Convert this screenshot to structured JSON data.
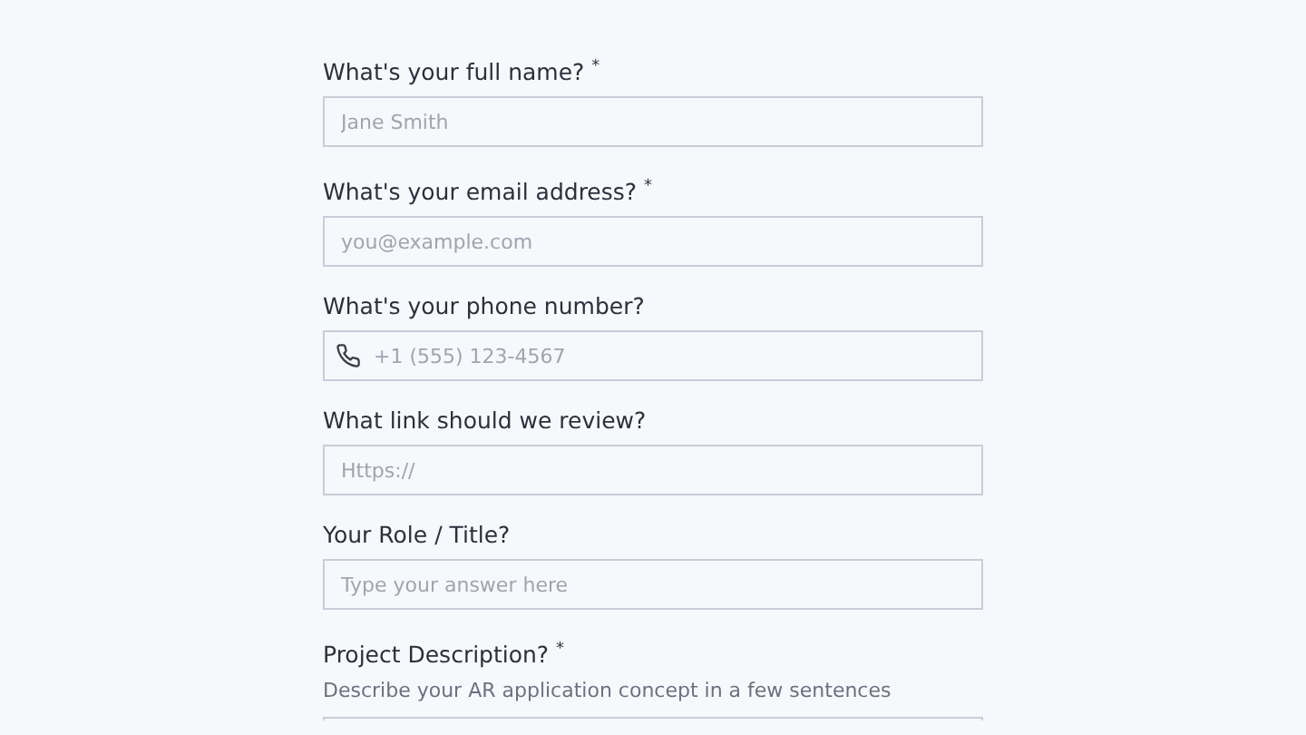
{
  "fields": [
    {
      "kind": "text",
      "label": "What's your full name? $^{*}$",
      "placeholder": "Jane Smith"
    },
    {
      "kind": "text",
      "label": "What's your email address? $^{*}$",
      "placeholder": "you@example.com"
    },
    {
      "kind": "phone",
      "label": "What's your phone number?",
      "placeholder": "+1 (555) 123-4567"
    },
    {
      "kind": "text",
      "label": "What link should we review?",
      "placeholder": "Https://"
    },
    {
      "kind": "text",
      "label": "Your Role / Title?",
      "placeholder": "Type your answer here"
    },
    {
      "kind": "textarea",
      "label": "Project Description? $^{*}$",
      "description": "Describe your AR application concept in a few sentences"
    }
  ]
}
